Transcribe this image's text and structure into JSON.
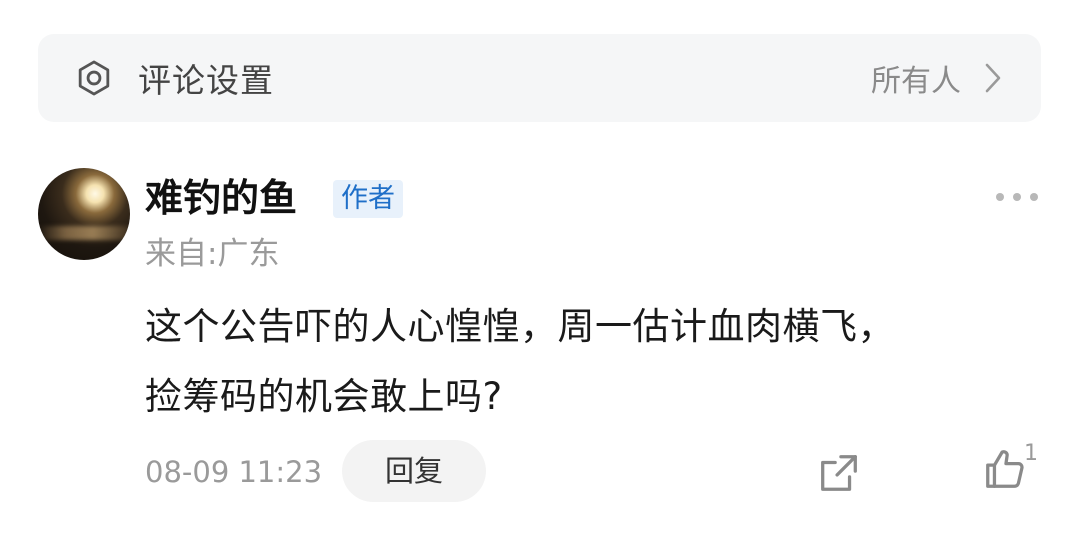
{
  "settings": {
    "icon": "gear-icon",
    "title": "评论设置",
    "value": "所有人",
    "chevron_icon": "chevron-right-icon"
  },
  "comment": {
    "avatar": "avatar-moon-image",
    "username": "难钓的鱼",
    "badge": "作者",
    "location": "来自:广东",
    "content_line1": "这个公告吓的人心惶惶，周一估计血肉横飞，",
    "content_line2": "捡筹码的机会敢上吗?",
    "timestamp": "08-09 11:23",
    "reply_label": "回复",
    "like_count": "1",
    "icons": {
      "more": "more-dots-icon",
      "share": "share-icon",
      "like": "thumbs-up-icon"
    }
  },
  "colors": {
    "badge_text": "#1f6fc8",
    "badge_bg": "#e8f1fb",
    "settings_bg": "#f5f6f7",
    "muted_text": "#9a9a9a"
  }
}
